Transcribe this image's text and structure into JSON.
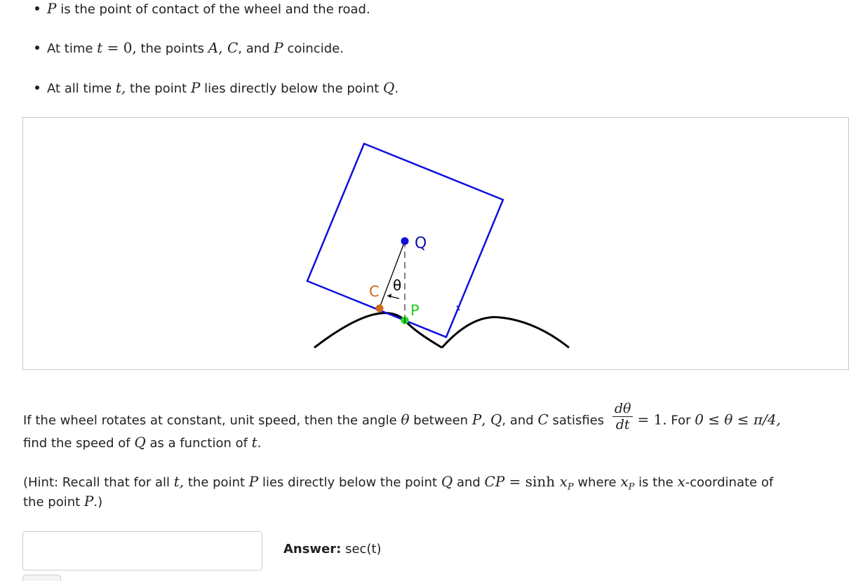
{
  "bullets": [
    {
      "var": "P",
      "text": " is the point of contact of the wheel and the road."
    },
    {
      "pre": "At time ",
      "math_t": "t",
      "math_eq": " = 0,",
      "mid": " the points ",
      "a": "A",
      "comma1": ", ",
      "c": "C",
      "comma2": ", and ",
      "p": "P",
      "post": " coincide."
    },
    {
      "pre": "At all time ",
      "math_t": "t,",
      "mid": " the point ",
      "p": "P",
      "mid2": " lies directly below the point ",
      "q": "Q",
      "post": "."
    }
  ],
  "figure": {
    "label_q": "Q",
    "label_c": "C",
    "label_p": "P",
    "label_theta": "θ",
    "colors": {
      "square": "#1010dd",
      "road": "#000000",
      "point_q": "#1010dd",
      "point_c": "#d2691e",
      "point_p": "#22dd22",
      "label_c": "#d2691e",
      "label_p": "#22cc22",
      "label_q": "#1010aa"
    }
  },
  "question": {
    "line1_pre": "If the wheel rotates at constant, unit speed, then the angle ",
    "theta": "θ",
    "line1_mid": " between ",
    "p": "P",
    "comma1": ", ",
    "q": "Q",
    "comma2": ", and ",
    "c": "C",
    "line1_post": " satisfies",
    "frac_num": "dθ",
    "frac_den": "dt",
    "eq": "= 1.",
    "for_text": " For ",
    "range": "0 ≤ θ ≤ π/4,",
    "line2_pre": "find the speed of ",
    "line2_q": "Q",
    "line2_mid": " as a function of ",
    "line2_t": "t",
    "line2_post": "."
  },
  "hint": {
    "pre": "(Hint: Recall that for all ",
    "t": "t,",
    "mid": " the point ",
    "p": "P",
    "mid2": " lies directly below the point ",
    "q": "Q",
    "and": " and ",
    "cp": "CP",
    "eq": " = sinh ",
    "xp": "x",
    "xp_sub": "P",
    "where": " where ",
    "xp2": "x",
    "xp2_sub": "P",
    "is": " is the ",
    "x": "x",
    "coord": "-coordinate of",
    "line2_pre": "the point ",
    "line2_p": "P",
    "line2_post": ".)"
  },
  "answer": {
    "input_value": "",
    "label_bold": "Answer:",
    "label_value": " sec(t)"
  }
}
